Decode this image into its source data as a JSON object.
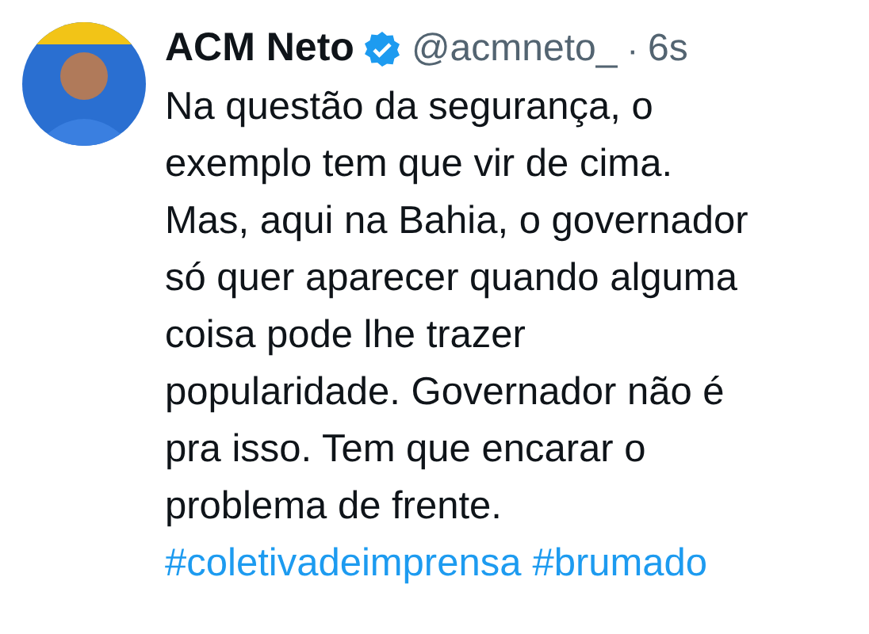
{
  "author": {
    "name": "ACM Neto",
    "verified": true,
    "handle": "@acmneto_",
    "separator": "·",
    "time": "6s"
  },
  "tweet": {
    "lines": [
      "Na questão da segurança, o",
      "exemplo tem que vir de cima.",
      "Mas, aqui na Bahia, o governador",
      "só quer aparecer quando alguma",
      "coisa pode lhe trazer",
      "popularidade. Governador não é",
      "pra isso. Tem que encarar o",
      "problema de frente."
    ],
    "hashtags": [
      "#coletivadeimprensa",
      "#brumado"
    ]
  }
}
